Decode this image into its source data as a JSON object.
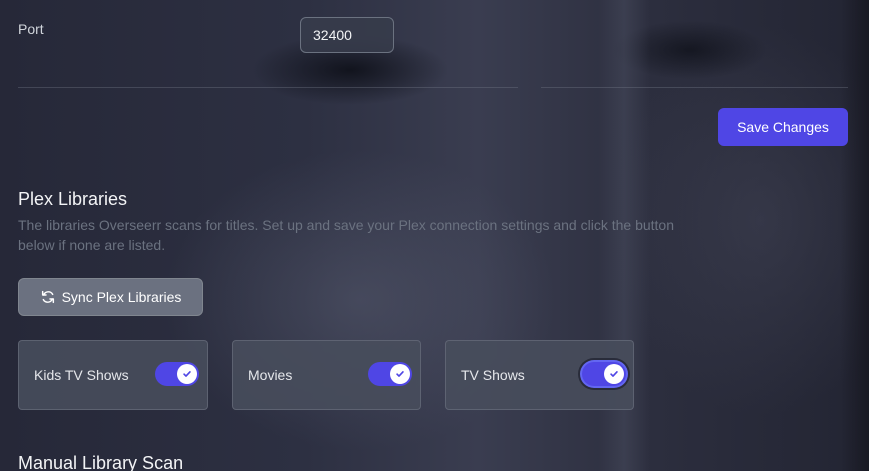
{
  "port": {
    "label": "Port",
    "value": "32400"
  },
  "save_button": {
    "label": "Save Changes"
  },
  "plex_libraries": {
    "title": "Plex Libraries",
    "description": "The libraries Overseerr scans for titles. Set up and save your Plex connection settings and click the button below if none are listed.",
    "sync_button_label": "Sync Plex Libraries",
    "sync_icon": "refresh-icon",
    "libraries": [
      {
        "name": "Kids TV Shows",
        "enabled": true
      },
      {
        "name": "Movies",
        "enabled": true
      },
      {
        "name": "TV Shows",
        "enabled": true
      }
    ]
  },
  "manual_scan": {
    "title": "Manual Library Scan"
  },
  "colors": {
    "accent": "#4f46e5",
    "secondary_button": "#6b7180",
    "muted_text": "#6b7280"
  }
}
